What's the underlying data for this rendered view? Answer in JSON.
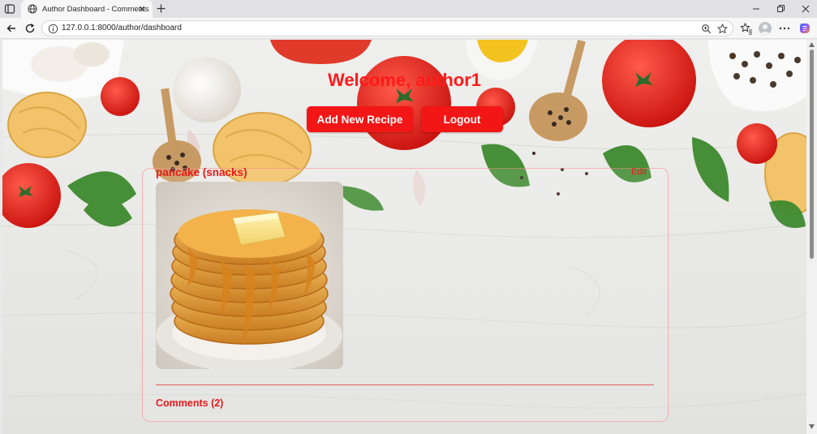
{
  "browser": {
    "tab_title": "Author Dashboard - Comments",
    "url": "127.0.0.1:8000/author/dashboard"
  },
  "page": {
    "welcome": "Welcome, author1",
    "buttons": {
      "add_recipe": "Add New Recipe",
      "logout": "Logout"
    },
    "recipe": {
      "title": "pancake (snacks)",
      "edit": "Edit",
      "comments": "Comments (2)"
    }
  },
  "icons": [
    "sidebar-icon",
    "globe-icon",
    "close-icon",
    "plus-icon",
    "minimize-icon",
    "restore-icon",
    "back-icon",
    "reload-icon",
    "info-icon",
    "zoom-icon",
    "star-icon",
    "favorites-icon",
    "profile-icon",
    "more-icon",
    "copilot-icon"
  ],
  "colors": {
    "accent_red": "#f21616",
    "heading_red": "#ff1a1a"
  }
}
